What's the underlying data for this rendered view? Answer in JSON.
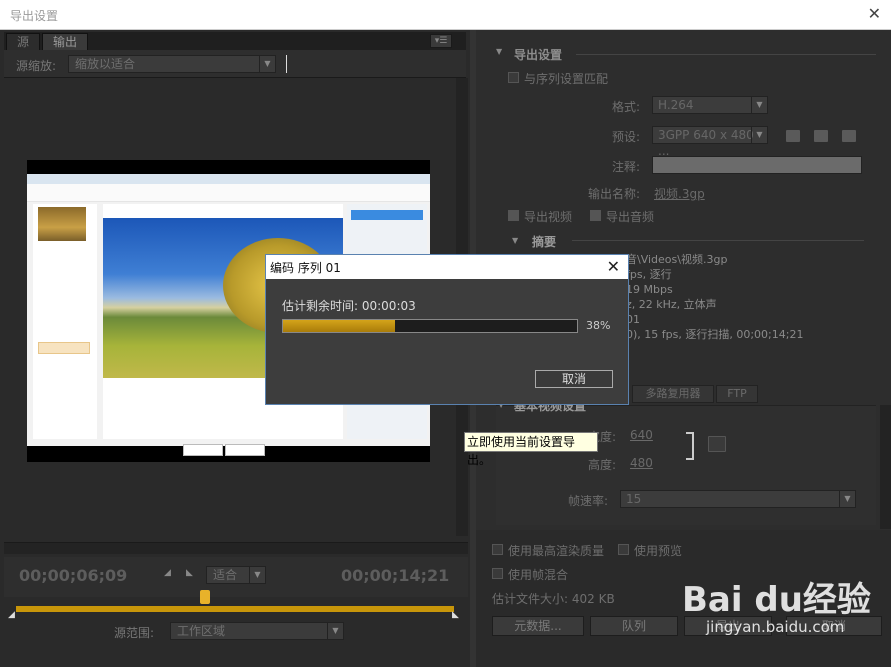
{
  "window": {
    "title": "导出设置",
    "close": "✕"
  },
  "left": {
    "tabs": [
      "源",
      "输出"
    ],
    "source_scaling_label": "源缩放:",
    "source_scaling_value": "缩放以适合",
    "timecode_start": "00;00;06;09",
    "timecode_end": "00;00;14;21",
    "fit_value": "适合",
    "source_range_label": "源范围:",
    "source_range_value": "工作区域"
  },
  "export_settings": {
    "section": "导出设置",
    "match_sequence": "与序列设置匹配",
    "format_label": "格式:",
    "format_value": "H.264",
    "preset_label": "预设:",
    "preset_value": "3GPP 640 x 480 ...",
    "comment_label": "注释:",
    "output_name_label": "输出名称:",
    "output_name_value": "视频.3gp",
    "export_video": "导出视频",
    "export_audio": "导出音频",
    "summary_label": "摘要",
    "summary_lines": [
      "音\\Videos\\视频.3gp",
      "fps, 逐行",
      "19 Mbps",
      "z, 22 kHz, 立体声",
      "01",
      "0), 15 fps, 逐行扫描, 00;00;14;21"
    ]
  },
  "tabs_right": [
    "多路复用器",
    "FTP"
  ],
  "video": {
    "basic_video": "基本视频设置",
    "width_label": "宽度:",
    "width_value": "640",
    "height_label": "高度:",
    "height_value": "480",
    "framerate_label": "帧速率:",
    "framerate_value": "15"
  },
  "bottom": {
    "max_render": "使用最高渲染质量",
    "use_preview": "使用预览",
    "use_frame_blend": "使用帧混合",
    "est_size": "估计文件大小: 402 KB",
    "metadata": "元数据...",
    "queue": "队列",
    "export": "导出",
    "cancel": "取消"
  },
  "dialog": {
    "title": "编码 序列 01",
    "remaining": "估计剩余时间: 00:00:03",
    "progress": 38,
    "percent_label": "38%",
    "cancel": "取消"
  },
  "tooltip": "立即使用当前设置导出。",
  "watermark": {
    "brand": "Bai du经验",
    "url": "jingyan.baidu.com"
  }
}
